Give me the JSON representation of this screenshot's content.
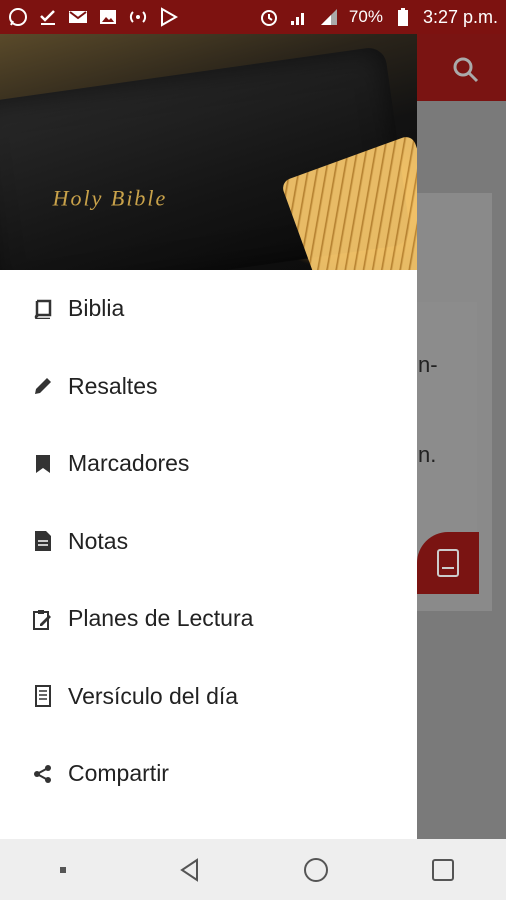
{
  "status_bar": {
    "battery_percent": "70%",
    "time": "3:27 p.m."
  },
  "drawer": {
    "header_image_text": "Holy Bible",
    "menu": [
      {
        "label": "Biblia",
        "icon": "book-icon"
      },
      {
        "label": "Resaltes",
        "icon": "pencil-icon"
      },
      {
        "label": "Marcadores",
        "icon": "bookmark-icon"
      },
      {
        "label": "Notas",
        "icon": "note-icon"
      },
      {
        "label": "Planes de Lectura",
        "icon": "reading-plan-icon"
      },
      {
        "label": "Versículo del día",
        "icon": "verse-of-day-icon"
      },
      {
        "label": "Compartir",
        "icon": "share-icon"
      }
    ]
  },
  "background_app": {
    "visible_fragments": [
      "n-",
      "n."
    ]
  },
  "colors": {
    "primary": "#7d1210",
    "drawer_bg": "#ffffff",
    "scrim": "#7a7a7a"
  }
}
